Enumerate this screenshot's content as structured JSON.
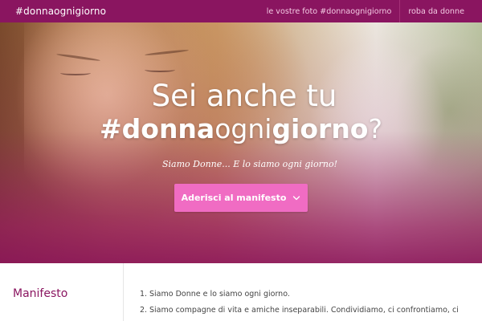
{
  "navbar": {
    "brand": "#donnaognigiorno",
    "links": [
      "le vostre foto #donnaognigiorno",
      "roba da donne"
    ]
  },
  "hero": {
    "line1": "Sei anche tu",
    "line2_bold1": "#donna",
    "line2_light1": "ogni",
    "line2_bold2": "giorno",
    "line2_light2": "?",
    "subtitle": "Siamo Donne... E lo siamo ogni giorno!",
    "cta_label": "Aderisci al manifesto",
    "cta_icon": "chevron-down-icon"
  },
  "manifesto": {
    "title": "Manifesto",
    "items": [
      {
        "num": "1.",
        "text": "Siamo Donne e lo siamo ogni giorno."
      },
      {
        "num": "2.",
        "text": "Siamo compagne di vita e amiche inseparabili. Condividiamo, ci confrontiamo, ci"
      }
    ]
  },
  "colors": {
    "brand": "#8a1560",
    "cta": "#f06cc3"
  }
}
